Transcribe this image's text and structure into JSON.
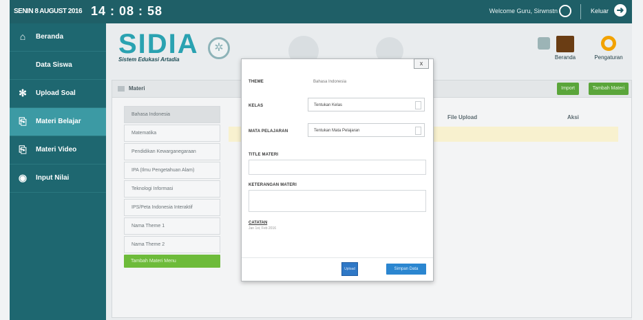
{
  "topbar": {
    "date": "SENIN 8 AUGUST 2016",
    "time": "14 : 08 : 58",
    "welcome": "Welcome Guru, Sirwnstn",
    "logout": "Keluar"
  },
  "sidebar": {
    "items": [
      {
        "label": "Beranda",
        "icon": "home-icon",
        "glyph": "⌂"
      },
      {
        "label": "Data Siswa",
        "icon": "users-icon",
        "glyph": ""
      },
      {
        "label": "Upload Soal",
        "icon": "group-icon",
        "glyph": "👥"
      },
      {
        "label": "Materi Belajar",
        "icon": "file-icon",
        "glyph": "⎘"
      },
      {
        "label": "Materi Video",
        "icon": "file-icon",
        "glyph": "⎘"
      },
      {
        "label": "Input Nilai",
        "icon": "eye-icon",
        "glyph": "◉"
      }
    ]
  },
  "header": {
    "logo": "SIDIA",
    "logo_sub": "Sistem Edukasi Artadia",
    "home_label": "Beranda",
    "settings_label": "Pengaturan"
  },
  "panel": {
    "title": "Materi",
    "btn_import": "Import",
    "btn_add": "Tambah Materi",
    "col_file": "File Upload",
    "col_aksi": "Aksi"
  },
  "themes": [
    "Bahasa Indonesia",
    "Matematika",
    "Pendidikan Kewarganegaraan",
    "IPA (Ilmu Pengetahuan Alam)",
    "Teknologi Informasi",
    "IPS/Peta Indonesia Interaktif",
    "Nama Theme 1",
    "Nama Theme 2"
  ],
  "theme_add": "Tambah Materi Menu",
  "modal": {
    "theme_label": "THEME",
    "theme_value": "Bahasa Indonesia",
    "kelas_label": "KELAS",
    "kelas_value": "Tentukan Kelas",
    "mapel_label": "MATA PELAJARAN",
    "mapel_value": "Tentukan Mata Pelajaran",
    "title_label": "TITLE MATERI",
    "ket_label": "KETERANGAN MATERI",
    "note_title": "CATATAN",
    "note_text": "Jan 1st, Feb 2016",
    "btn_small": "Upload",
    "btn_save": "Simpan Data",
    "close": "x"
  }
}
